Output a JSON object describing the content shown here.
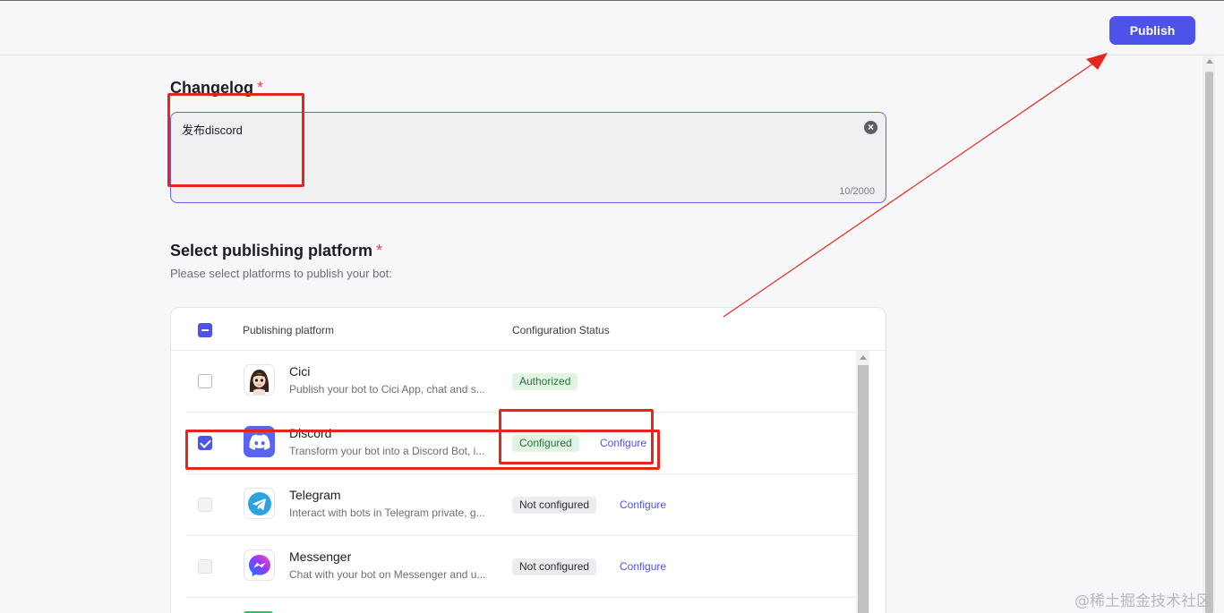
{
  "toolbar": {
    "publish_label": "Publish"
  },
  "changelog": {
    "title": "Changelog",
    "required_mark": "*",
    "value": "发布discord",
    "clear_icon": "×",
    "counter": "10/2000"
  },
  "platforms": {
    "title": "Select publishing platform",
    "required_mark": "*",
    "subtitle": "Please select platforms to publish your bot:",
    "header": {
      "platform": "Publishing platform",
      "status": "Configuration Status"
    },
    "rows": [
      {
        "name": "Cici",
        "description": "Publish your bot to Cici App, chat and s...",
        "status": "Authorized",
        "status_kind": "ok",
        "configure": "",
        "checked": false,
        "disabled": false,
        "icon": "cici-avatar-icon"
      },
      {
        "name": "Discord",
        "description": "Transform your bot into a Discord Bot, i...",
        "status": "Configured",
        "status_kind": "ok",
        "configure": "Configure",
        "checked": true,
        "disabled": false,
        "icon": "discord-icon"
      },
      {
        "name": "Telegram",
        "description": "Interact with bots in Telegram private, g...",
        "status": "Not configured",
        "status_kind": "no",
        "configure": "Configure",
        "checked": false,
        "disabled": true,
        "icon": "telegram-icon"
      },
      {
        "name": "Messenger",
        "description": "Chat with your bot on Messenger and u...",
        "status": "Not configured",
        "status_kind": "no",
        "configure": "Configure",
        "checked": false,
        "disabled": true,
        "icon": "messenger-icon"
      }
    ]
  },
  "colors": {
    "accent": "#4d53e8",
    "annotation": "#e5261f",
    "ok_badge_bg": "#e2f5e5",
    "ok_badge_text": "#28703a"
  },
  "watermark": "@稀土掘金技术社区"
}
